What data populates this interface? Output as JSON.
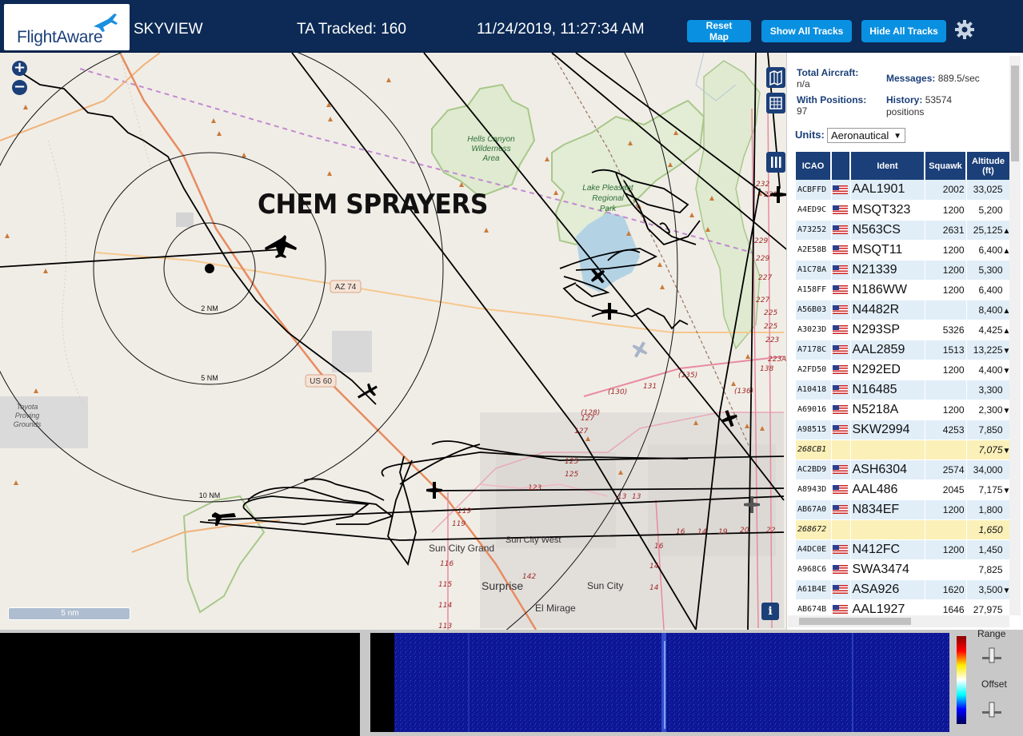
{
  "header": {
    "logo_text": "FlightAware",
    "app_name": "SKYVIEW",
    "tracked": "TA Tracked: 160",
    "datetime": "11/24/2019, 11:27:34 AM",
    "buttons": {
      "reset": "Reset Map",
      "show_all": "Show All Tracks",
      "hide_all": "Hide All Tracks"
    }
  },
  "map": {
    "overlay_text": "CHEM SPRAYERS",
    "scale": "5 nm",
    "rings": [
      "2 NM",
      "5 NM",
      "10 NM"
    ],
    "labels": {
      "hells_canyon": "Hells Canyon",
      "wilderness": "Wilderness",
      "area": "Area",
      "lake_pleasant": "Lake Pleasant",
      "regional": "Regional",
      "park": "Park",
      "toyota": "Toyota",
      "proving": "Proving",
      "grounds": "Grounds",
      "az74": "AZ 74",
      "us60": "US 60",
      "sun_city_grand": "Sun City Grand",
      "sun_city_west": "Sun City West",
      "surprise": "Surprise",
      "sun_city": "Sun City",
      "el_mirage": "El Mirage"
    },
    "info": "i"
  },
  "stats": {
    "total_label": "Total Aircraft:",
    "total_value": "n/a",
    "messages_label": "Messages:",
    "messages_value": "889.5/sec",
    "positions_label": "With Positions:",
    "positions_value": "97",
    "history_label": "History:",
    "history_value": "53574",
    "history_unit": "positions"
  },
  "units": {
    "label": "Units:",
    "selected": "Aeronautical"
  },
  "table": {
    "headers": {
      "icao": "ICAO",
      "ident": "Ident",
      "squawk": "Squawk",
      "altitude": "Altitude (ft)"
    },
    "rows": [
      {
        "icao": "ACBFFD",
        "ident": "AAL1901",
        "squawk": "2002",
        "alt": "33,025",
        "trend": ""
      },
      {
        "icao": "A4ED9C",
        "ident": "MSQT323",
        "squawk": "1200",
        "alt": "5,200",
        "trend": ""
      },
      {
        "icao": "A73252",
        "ident": "N563CS",
        "squawk": "2631",
        "alt": "25,125",
        "trend": "▲"
      },
      {
        "icao": "A2E58B",
        "ident": "MSQT11",
        "squawk": "1200",
        "alt": "6,400",
        "trend": "▲"
      },
      {
        "icao": "A1C78A",
        "ident": "N21339",
        "squawk": "1200",
        "alt": "5,300",
        "trend": ""
      },
      {
        "icao": "A158FF",
        "ident": "N186WW",
        "squawk": "1200",
        "alt": "6,400",
        "trend": ""
      },
      {
        "icao": "A56B03",
        "ident": "N4482R",
        "squawk": "",
        "alt": "8,400",
        "trend": "▲"
      },
      {
        "icao": "A3023D",
        "ident": "N293SP",
        "squawk": "5326",
        "alt": "4,425",
        "trend": "▲"
      },
      {
        "icao": "A7178C",
        "ident": "AAL2859",
        "squawk": "1513",
        "alt": "13,225",
        "trend": "▼"
      },
      {
        "icao": "A2FD50",
        "ident": "N292ED",
        "squawk": "1200",
        "alt": "4,400",
        "trend": "▼"
      },
      {
        "icao": "A10418",
        "ident": "N16485",
        "squawk": "",
        "alt": "3,300",
        "trend": ""
      },
      {
        "icao": "A69016",
        "ident": "N5218A",
        "squawk": "1200",
        "alt": "2,300",
        "trend": "▼"
      },
      {
        "icao": "A98515",
        "ident": "SKW2994",
        "squawk": "4253",
        "alt": "7,850",
        "trend": ""
      },
      {
        "icao": "268CB1",
        "ident": "",
        "squawk": "",
        "alt": "7,075",
        "trend": "▼",
        "noflag": true,
        "highlight": true
      },
      {
        "icao": "AC2BD9",
        "ident": "ASH6304",
        "squawk": "2574",
        "alt": "34,000",
        "trend": ""
      },
      {
        "icao": "A8943D",
        "ident": "AAL486",
        "squawk": "2045",
        "alt": "7,175",
        "trend": "▼"
      },
      {
        "icao": "AB67A0",
        "ident": "N834EF",
        "squawk": "1200",
        "alt": "1,800",
        "trend": ""
      },
      {
        "icao": "268672",
        "ident": "",
        "squawk": "",
        "alt": "1,650",
        "trend": "",
        "noflag": true,
        "highlight": true
      },
      {
        "icao": "A4DC0E",
        "ident": "N412FC",
        "squawk": "1200",
        "alt": "1,450",
        "trend": ""
      },
      {
        "icao": "A968C6",
        "ident": "SWA3474",
        "squawk": "",
        "alt": "7,825",
        "trend": ""
      },
      {
        "icao": "A61B4E",
        "ident": "ASA926",
        "squawk": "1620",
        "alt": "3,500",
        "trend": "▼"
      },
      {
        "icao": "AB674B",
        "ident": "AAL1927",
        "squawk": "1646",
        "alt": "27,975",
        "trend": ""
      }
    ]
  },
  "waterfall": {
    "range_label": "Range",
    "offset_label": "Offset"
  }
}
